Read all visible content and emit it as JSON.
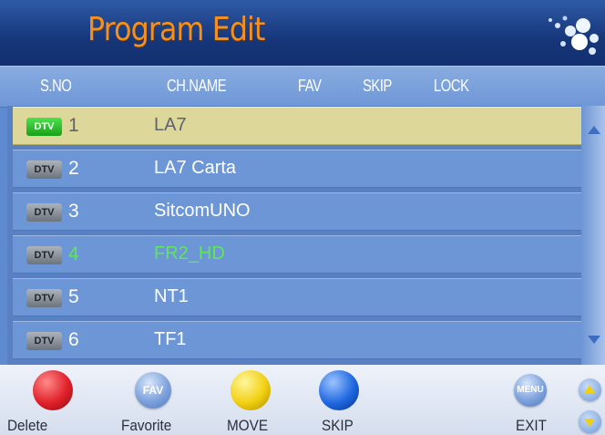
{
  "header": {
    "title": "Program Edit"
  },
  "columns": {
    "sno": "S.NO",
    "chname": "CH.NAME",
    "fav": "FAV",
    "skip": "SKIP",
    "lock": "LOCK"
  },
  "channels": [
    {
      "badge": "DTV",
      "number": "1",
      "name": "LA7",
      "selected": true
    },
    {
      "badge": "DTV",
      "number": "2",
      "name": "LA7 Carta"
    },
    {
      "badge": "DTV",
      "number": "3",
      "name": "SitcomUNO"
    },
    {
      "badge": "DTV",
      "number": "4",
      "name": "FR2_HD",
      "highlight_color": "#5fe65a"
    },
    {
      "badge": "DTV",
      "number": "5",
      "name": "NT1"
    },
    {
      "badge": "DTV",
      "number": "6",
      "name": "TF1"
    }
  ],
  "footer": {
    "delete_label": "Delete",
    "favorite_label": "Favorite",
    "favorite_icon": "FAV",
    "move_label": "MOVE",
    "skip_label": "SKIP",
    "exit_label": "EXIT",
    "menu_icon": "MENU"
  },
  "colors": {
    "title": "#f4901e",
    "selected_row": "#ddd79a",
    "row": "#6d96d6",
    "delete_button": "#e0202a",
    "move_button": "#f2d010",
    "skip_button": "#1e68e0",
    "dtv_badge_selected": "#2cc02c"
  }
}
